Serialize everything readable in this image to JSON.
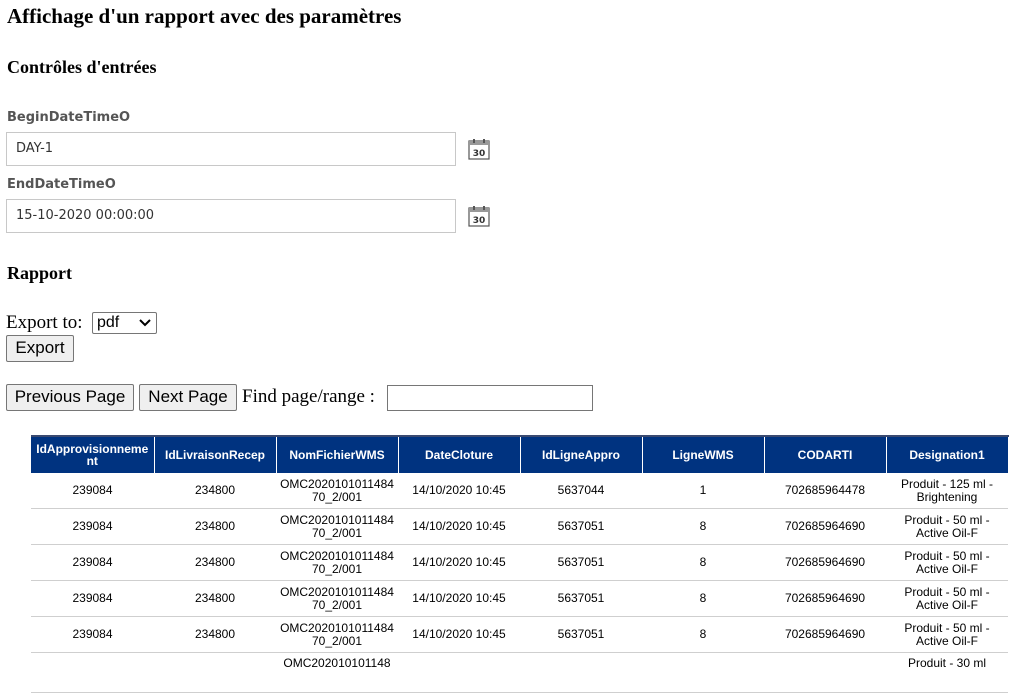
{
  "page": {
    "title": "Affichage d'un rapport avec des paramètres",
    "controls_heading": "Contrôles d'entrées",
    "report_heading": "Rapport"
  },
  "params": [
    {
      "label": "BeginDateTimeO",
      "value": "DAY-1",
      "icon": "calendar-icon",
      "day": "30"
    },
    {
      "label": "EndDateTimeO",
      "value": "15-10-2020 00:00:00",
      "icon": "calendar-icon",
      "day": "30"
    }
  ],
  "export": {
    "label": "Export to:",
    "selected": "pdf",
    "button": "Export"
  },
  "paging": {
    "previous": "Previous Page",
    "next": "Next Page",
    "find_label": "Find page/range :",
    "find_value": ""
  },
  "table": {
    "header_color": "#003380",
    "columns": [
      "IdApprovisionnement",
      "IdLivraisonRecep",
      "NomFichierWMS",
      "DateCloture",
      "IdLigneAppro",
      "LigneWMS",
      "CODARTI",
      "Designation1"
    ],
    "rows": [
      [
        "239084",
        "234800",
        "OMC202010101148470_2/001",
        "14/10/2020  10:45",
        "5637044",
        "1",
        "702685964478",
        "Produit - 125 ml - Brightening"
      ],
      [
        "239084",
        "234800",
        "OMC202010101148470_2/001",
        "14/10/2020  10:45",
        "5637051",
        "8",
        "702685964690",
        "Produit - 50 ml - Active Oil-F"
      ],
      [
        "239084",
        "234800",
        "OMC202010101148470_2/001",
        "14/10/2020  10:45",
        "5637051",
        "8",
        "702685964690",
        "Produit - 50 ml - Active Oil-F"
      ],
      [
        "239084",
        "234800",
        "OMC202010101148470_2/001",
        "14/10/2020  10:45",
        "5637051",
        "8",
        "702685964690",
        "Produit - 50 ml - Active Oil-F"
      ],
      [
        "239084",
        "234800",
        "OMC202010101148470_2/001",
        "14/10/2020  10:45",
        "5637051",
        "8",
        "702685964690",
        "Produit - 50 ml - Active Oil-F"
      ],
      [
        "",
        "",
        "OMC202010101148",
        "",
        "",
        "",
        "",
        "Produit - 30 ml"
      ]
    ]
  }
}
